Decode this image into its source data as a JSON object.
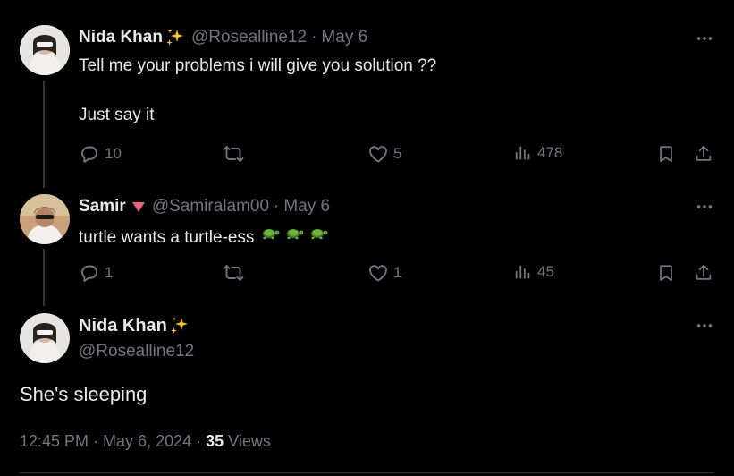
{
  "thread": {
    "tweets": [
      {
        "name": "Nida Khan",
        "handle": "@Rosealline12",
        "date": "May 6",
        "text_lines": [
          "Tell me your problems i will give you solution ??",
          "Just say it"
        ],
        "stats": {
          "replies": "10",
          "reposts": "",
          "likes": "5",
          "views": "478"
        }
      },
      {
        "name": "Samir",
        "handle": "@Samiralam00",
        "date": "May 6",
        "text_lines": [
          "turtle wants a turtle-ess"
        ],
        "stats": {
          "replies": "1",
          "reposts": "",
          "likes": "1",
          "views": "45"
        }
      }
    ],
    "separator": "·"
  },
  "focus_tweet": {
    "name": "Nida Khan",
    "handle": "@Rosealline12",
    "text": "She's sleeping",
    "time": "12:45 PM",
    "date": "May 6, 2024",
    "views_count": "35",
    "views_label": "Views"
  },
  "colors": {
    "background": "#000000",
    "text_primary": "#e7e9ea",
    "text_secondary": "#71767b",
    "sparkle": "#f5c518",
    "verified_triangle": "#f0607a",
    "turtle": "#5aa630"
  },
  "icons": [
    "more-icon",
    "reply-icon",
    "repost-icon",
    "like-icon",
    "views-icon",
    "bookmark-icon",
    "share-icon",
    "sparkles-icon",
    "triangle-icon",
    "turtle-icon"
  ]
}
